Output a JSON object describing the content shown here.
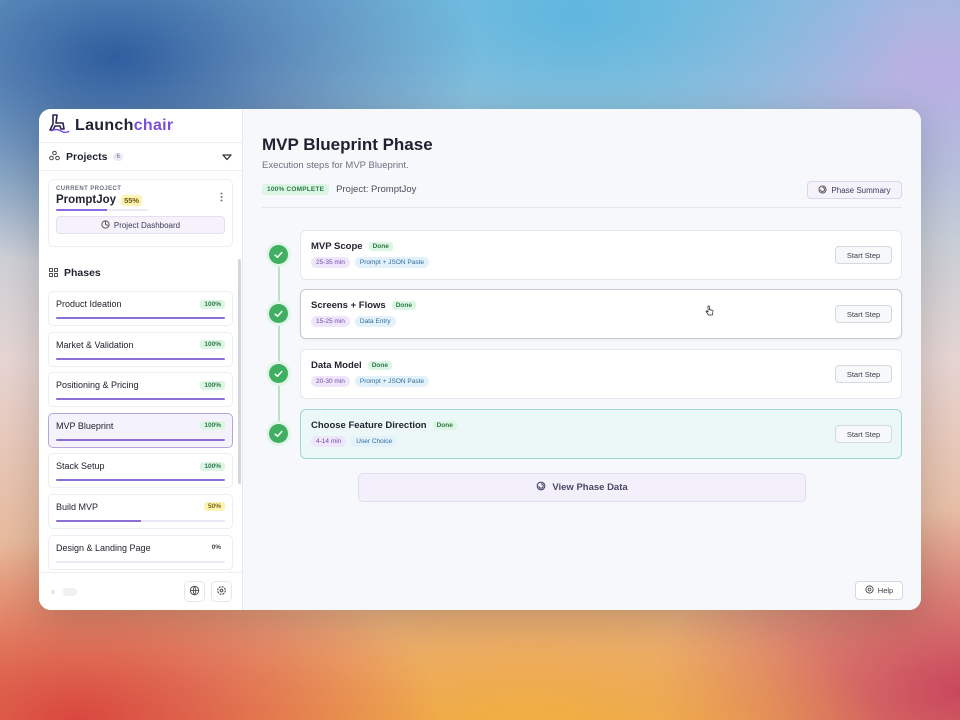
{
  "brand": {
    "name_prefix": "Launch",
    "name_suffix": "chair"
  },
  "projects": {
    "label": "Projects",
    "count": "6"
  },
  "current_project": {
    "label": "CURRENT PROJECT",
    "name": "PromptJoy",
    "progress_label": "55%",
    "progress": 0.55,
    "dashboard_label": "Project Dashboard"
  },
  "phases_title": "Phases",
  "phases": [
    {
      "name": "Product Ideation",
      "pct": "100%",
      "progress": 1.0,
      "pill": "green"
    },
    {
      "name": "Market & Validation",
      "pct": "100%",
      "progress": 1.0,
      "pill": "green"
    },
    {
      "name": "Positioning & Pricing",
      "pct": "100%",
      "progress": 1.0,
      "pill": "green"
    },
    {
      "name": "MVP Blueprint",
      "pct": "100%",
      "progress": 1.0,
      "pill": "green",
      "active": true
    },
    {
      "name": "Stack Setup",
      "pct": "100%",
      "progress": 1.0,
      "pill": "green"
    },
    {
      "name": "Build MVP",
      "pct": "50%",
      "progress": 0.5,
      "pill": "yellow"
    },
    {
      "name": "Design & Landing Page",
      "pct": "0%",
      "progress": 0,
      "pill": "plain"
    }
  ],
  "main": {
    "title": "MVP Blueprint Phase",
    "subtitle": "Execution steps for MVP Blueprint.",
    "complete_label": "100% COMPLETE",
    "project_text": "Project: PromptJoy",
    "summary_button": "Phase Summary",
    "view_data_button": "View Phase Data",
    "help_button": "Help"
  },
  "steps": [
    {
      "name": "MVP Scope",
      "status": "Done",
      "time": "25-35 min",
      "type": "Prompt + JSON Paste",
      "button": "Start Step"
    },
    {
      "name": "Screens + Flows",
      "status": "Done",
      "time": "15-25 min",
      "type": "Data Entry",
      "button": "Start Step"
    },
    {
      "name": "Data Model",
      "status": "Done",
      "time": "20-30 min",
      "type": "Prompt + JSON Paste",
      "button": "Start Step"
    },
    {
      "name": "Choose Feature Direction",
      "status": "Done",
      "time": "4-14 min",
      "type": "User Choice",
      "button": "Start Step"
    }
  ],
  "colors": {
    "accent": "#7a4fd8",
    "progress": "#8c6fd6",
    "done_green": "#3fb061",
    "selected_bg": "#ecf8f8"
  }
}
